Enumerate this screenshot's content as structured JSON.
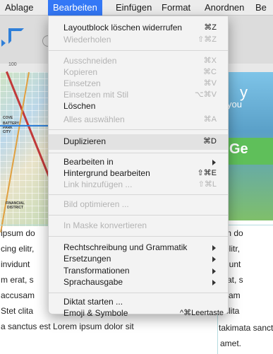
{
  "menubar": {
    "items": [
      "Ablage",
      "Bearbeiten",
      "Einfügen",
      "Format",
      "Anordnen",
      "Be"
    ]
  },
  "colors": {
    "accent": "#3478f6",
    "menu_bg": "#f3f3f3",
    "disabled": "#b3b3b3"
  },
  "document": {
    "ruler_number": "100",
    "map_labels": [
      "COVE",
      "BATTERY",
      "PARK",
      "CITY",
      "FINANCIAL",
      "DISTRICT"
    ],
    "photo_text1": "y",
    "photo_text1b": "you",
    "photo_text2": "Ge",
    "left_lines": [
      "ipsum do",
      "cing elitr,",
      " invidunt",
      "m erat, s",
      "accusam",
      " Stet clita",
      "a sanctus est Lorem ipsum dolor sit"
    ],
    "right_lines": [
      "m do",
      "elitr,",
      "dunt",
      "rat, s",
      "sam",
      " clita",
      "takimata sanctu",
      "amet."
    ]
  },
  "menu": {
    "items": [
      {
        "label": "Layoutblock löschen widerrufen",
        "shortcut": "⌘Z",
        "disabled": false
      },
      {
        "label": "Wiederholen",
        "shortcut": "⇧⌘Z",
        "disabled": true
      },
      {
        "label": "Ausschneiden",
        "shortcut": "⌘X",
        "disabled": true
      },
      {
        "label": "Kopieren",
        "shortcut": "⌘C",
        "disabled": true
      },
      {
        "label": "Einsetzen",
        "shortcut": "⌘V",
        "disabled": true
      },
      {
        "label": "Einsetzen mit Stil",
        "shortcut": "⌥⌘V",
        "disabled": true
      },
      {
        "label": "Löschen",
        "shortcut": "",
        "disabled": false
      },
      {
        "label": "Alles auswählen",
        "shortcut": "⌘A",
        "disabled": true
      },
      {
        "label": "Duplizieren",
        "shortcut": "⌘D",
        "disabled": false
      },
      {
        "label": "Bearbeiten in",
        "shortcut": "",
        "disabled": false
      },
      {
        "label": "Hintergrund bearbeiten",
        "shortcut": "⇧⌘E",
        "disabled": false
      },
      {
        "label": "Link hinzufügen ...",
        "shortcut": "⇧⌘L",
        "disabled": true
      },
      {
        "label": "Bild optimieren ...",
        "shortcut": "",
        "disabled": true
      },
      {
        "label": "In Maske konvertieren",
        "shortcut": "",
        "disabled": true
      },
      {
        "label": "Rechtschreibung und Grammatik",
        "shortcut": "",
        "disabled": false
      },
      {
        "label": "Ersetzungen",
        "shortcut": "",
        "disabled": false
      },
      {
        "label": "Transformationen",
        "shortcut": "",
        "disabled": false
      },
      {
        "label": "Sprachausgabe",
        "shortcut": "",
        "disabled": false
      },
      {
        "label": "Diktat starten ...",
        "shortcut": "",
        "disabled": false
      },
      {
        "label": "Emoji & Symbole",
        "shortcut": "^⌘Leertaste",
        "disabled": false
      }
    ]
  }
}
